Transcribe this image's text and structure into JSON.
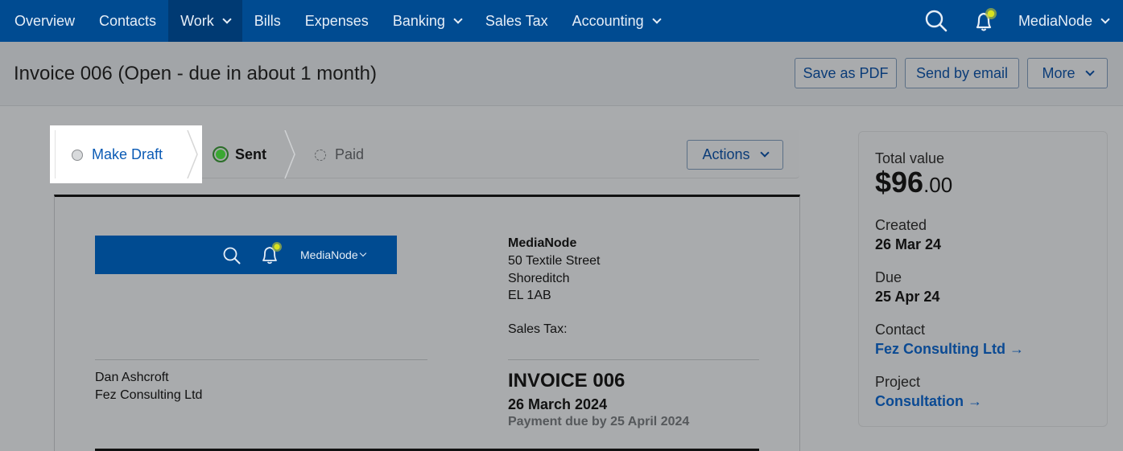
{
  "nav": {
    "items": [
      {
        "label": "Overview",
        "dropdown": false,
        "active": false
      },
      {
        "label": "Contacts",
        "dropdown": false,
        "active": false
      },
      {
        "label": "Work",
        "dropdown": true,
        "active": true
      },
      {
        "label": "Bills",
        "dropdown": false,
        "active": false
      },
      {
        "label": "Expenses",
        "dropdown": false,
        "active": false
      },
      {
        "label": "Banking",
        "dropdown": true,
        "active": false
      },
      {
        "label": "Sales Tax",
        "dropdown": false,
        "active": false
      },
      {
        "label": "Accounting",
        "dropdown": true,
        "active": false
      }
    ],
    "user": "MediaNode",
    "icons": [
      "search-icon",
      "notification-bell-icon"
    ]
  },
  "header": {
    "title": "Invoice 006 (Open - due in about 1 month)",
    "save_pdf": "Save as PDF",
    "send_email": "Send by email",
    "more": "More"
  },
  "status": {
    "draft": "Make Draft",
    "sent": "Sent",
    "paid": "Paid",
    "actions": "Actions"
  },
  "document": {
    "banner_user": "MediaNode",
    "company": {
      "name": "MediaNode",
      "address": [
        "50 Textile Street",
        "Shoreditch",
        "EL 1AB"
      ],
      "sales_tax_label": "Sales Tax:"
    },
    "recipient": {
      "name": "Dan Ashcroft",
      "company": "Fez Consulting Ltd"
    },
    "invoice_title": "INVOICE 006",
    "date": "26 March 2024",
    "payment_due": "Payment due by 25 April 2024"
  },
  "summary": {
    "total_label": "Total value",
    "total_whole": "$96",
    "total_cents": ".00",
    "created_label": "Created",
    "created_value": "26 Mar 24",
    "due_label": "Due",
    "due_value": "25 Apr 24",
    "contact_label": "Contact",
    "contact_value": "Fez Consulting Ltd →",
    "project_label": "Project",
    "project_value": "Consultation →"
  },
  "colors": {
    "nav_bg": "#004b91",
    "nav_active": "#003a73",
    "link": "#0b4a93",
    "sent_green": "#3aa832",
    "bell_dot": "#d8e21f"
  }
}
